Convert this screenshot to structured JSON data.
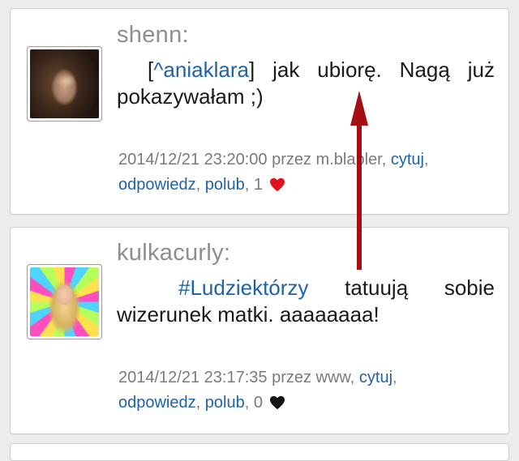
{
  "posts": [
    {
      "username": "shenn:",
      "body_prefix": "[",
      "body_link": "^aniaklara",
      "body_suffix": "] jak ubiorę. Nagą już pokazywałam ;)",
      "timestamp": "2014/12/21 23:20:00",
      "przez": "przez",
      "source": "m.blabler",
      "cytuj": "cytuj",
      "odpowiedz": "odpowiedz",
      "polub": "polub",
      "likes": "1",
      "liked": true
    },
    {
      "username": "kulkacurly:",
      "body_prefix": "",
      "body_link": "#Ludziektórzy",
      "body_suffix": " tatuują sobie wizerunek matki. aaaaaaaa!",
      "timestamp": "2014/12/21 23:17:35",
      "przez": "przez",
      "source": "www",
      "cytuj": "cytuj",
      "odpowiedz": "odpowiedz",
      "polub": "polub",
      "likes": "0",
      "liked": false
    }
  ],
  "colors": {
    "link": "#1e63a8",
    "heart_liked": "#e0121f",
    "heart_default": "#111111",
    "annotation_arrow": "#a50e12"
  }
}
